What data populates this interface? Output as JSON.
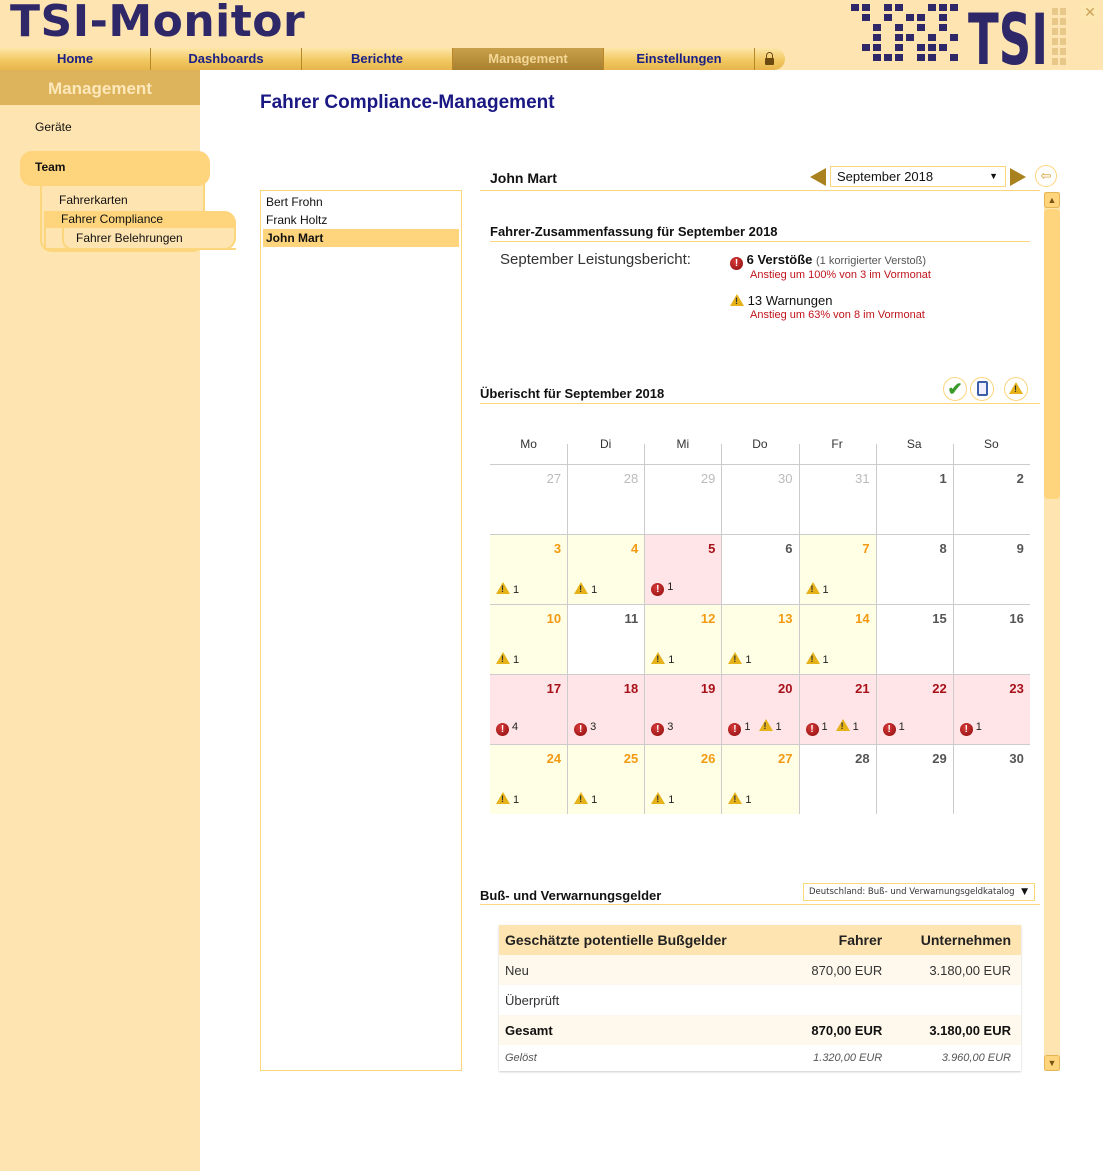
{
  "app": {
    "title": "TSI-Monitor",
    "logo_text": "TSI"
  },
  "nav": {
    "items": [
      {
        "label": "Home",
        "active": false
      },
      {
        "label": "Dashboards",
        "active": false
      },
      {
        "label": "Berichte",
        "active": false
      },
      {
        "label": "Management",
        "active": true
      },
      {
        "label": "Einstellungen",
        "active": false
      }
    ]
  },
  "sidebar": {
    "heading": "Management",
    "items": {
      "geraete": "Geräte",
      "team": "Team",
      "fahrerkarten": "Fahrerkarten",
      "fahrer_compliance": "Fahrer Compliance",
      "fahrer_belehrungen": "Fahrer Belehrungen"
    }
  },
  "page_title": "Fahrer Compliance-Management",
  "drivers": [
    {
      "name": "Bert Frohn",
      "selected": false
    },
    {
      "name": "Frank Holtz",
      "selected": false
    },
    {
      "name": "John Mart",
      "selected": true
    }
  ],
  "detail": {
    "driver_name": "John Mart",
    "month_select": "September 2018"
  },
  "summary": {
    "title": "Fahrer-Zusammenfassung für September 2018",
    "perf_label": "September Leistungsbericht:",
    "violations_main": "6 Verstöße",
    "violations_note": "(1 korrigierter Verstoß)",
    "violations_trend": "Anstieg um 100% von 3 im Vormonat",
    "warnings_main": "13 Warnungen",
    "warnings_trend": "Anstieg um 63% von 8 im Vormonat"
  },
  "overview": {
    "title": "Überischt für September 2018",
    "weekdays": [
      "Mo",
      "Di",
      "Mi",
      "Do",
      "Fr",
      "Sa",
      "So"
    ],
    "weeks": [
      [
        {
          "day": "27",
          "type": "other"
        },
        {
          "day": "28",
          "type": "other"
        },
        {
          "day": "29",
          "type": "other"
        },
        {
          "day": "30",
          "type": "other"
        },
        {
          "day": "31",
          "type": "other"
        },
        {
          "day": "1",
          "type": "normal"
        },
        {
          "day": "2",
          "type": "normal"
        }
      ],
      [
        {
          "day": "3",
          "type": "warn",
          "warnings": 1
        },
        {
          "day": "4",
          "type": "warn",
          "warnings": 1
        },
        {
          "day": "5",
          "type": "err",
          "errors": 1
        },
        {
          "day": "6",
          "type": "normal"
        },
        {
          "day": "7",
          "type": "warn",
          "warnings": 1
        },
        {
          "day": "8",
          "type": "normal"
        },
        {
          "day": "9",
          "type": "normal"
        }
      ],
      [
        {
          "day": "10",
          "type": "warn",
          "warnings": 1
        },
        {
          "day": "11",
          "type": "normal"
        },
        {
          "day": "12",
          "type": "warn",
          "warnings": 1
        },
        {
          "day": "13",
          "type": "warn",
          "warnings": 1
        },
        {
          "day": "14",
          "type": "warn",
          "warnings": 1
        },
        {
          "day": "15",
          "type": "normal"
        },
        {
          "day": "16",
          "type": "normal"
        }
      ],
      [
        {
          "day": "17",
          "type": "err",
          "errors": 4
        },
        {
          "day": "18",
          "type": "err",
          "errors": 3
        },
        {
          "day": "19",
          "type": "err",
          "errors": 3
        },
        {
          "day": "20",
          "type": "err",
          "errors": 1,
          "warnings": 1
        },
        {
          "day": "21",
          "type": "err",
          "errors": 1,
          "warnings": 1
        },
        {
          "day": "22",
          "type": "err",
          "errors": 1
        },
        {
          "day": "23",
          "type": "err",
          "errors": 1
        }
      ],
      [
        {
          "day": "24",
          "type": "warn",
          "warnings": 1
        },
        {
          "day": "25",
          "type": "warn",
          "warnings": 1
        },
        {
          "day": "26",
          "type": "warn",
          "warnings": 1
        },
        {
          "day": "27",
          "type": "warn",
          "warnings": 1
        },
        {
          "day": "28",
          "type": "normal"
        },
        {
          "day": "29",
          "type": "normal"
        },
        {
          "day": "30",
          "type": "normal"
        }
      ]
    ]
  },
  "fines": {
    "title": "Buß- und Verwarnungsgelder",
    "catalog_select": "Deutschland: Buß- und Verwarnungsgeldkatalog",
    "columns": [
      "Geschätzte potentielle Bußgelder",
      "Fahrer",
      "Unternehmen"
    ],
    "rows": [
      {
        "label": "Neu",
        "driver": "870,00 EUR",
        "company": "3.180,00 EUR",
        "cls": "r-neu"
      },
      {
        "label": "Überprüft",
        "driver": "",
        "company": "",
        "cls": "r-ueberprueft"
      },
      {
        "label": "Gesamt",
        "driver": "870,00 EUR",
        "company": "3.180,00 EUR",
        "cls": "r-gesamt"
      },
      {
        "label": "Gelöst",
        "driver": "1.320,00 EUR",
        "company": "3.960,00 EUR",
        "cls": "r-geloest"
      }
    ]
  },
  "colors": {
    "brand_navy": "#2e2868",
    "header_bg": "#fee4b1",
    "accent_gold": "#fed57d",
    "violation_red": "#a8111a",
    "warning_orange": "#f39a12"
  }
}
